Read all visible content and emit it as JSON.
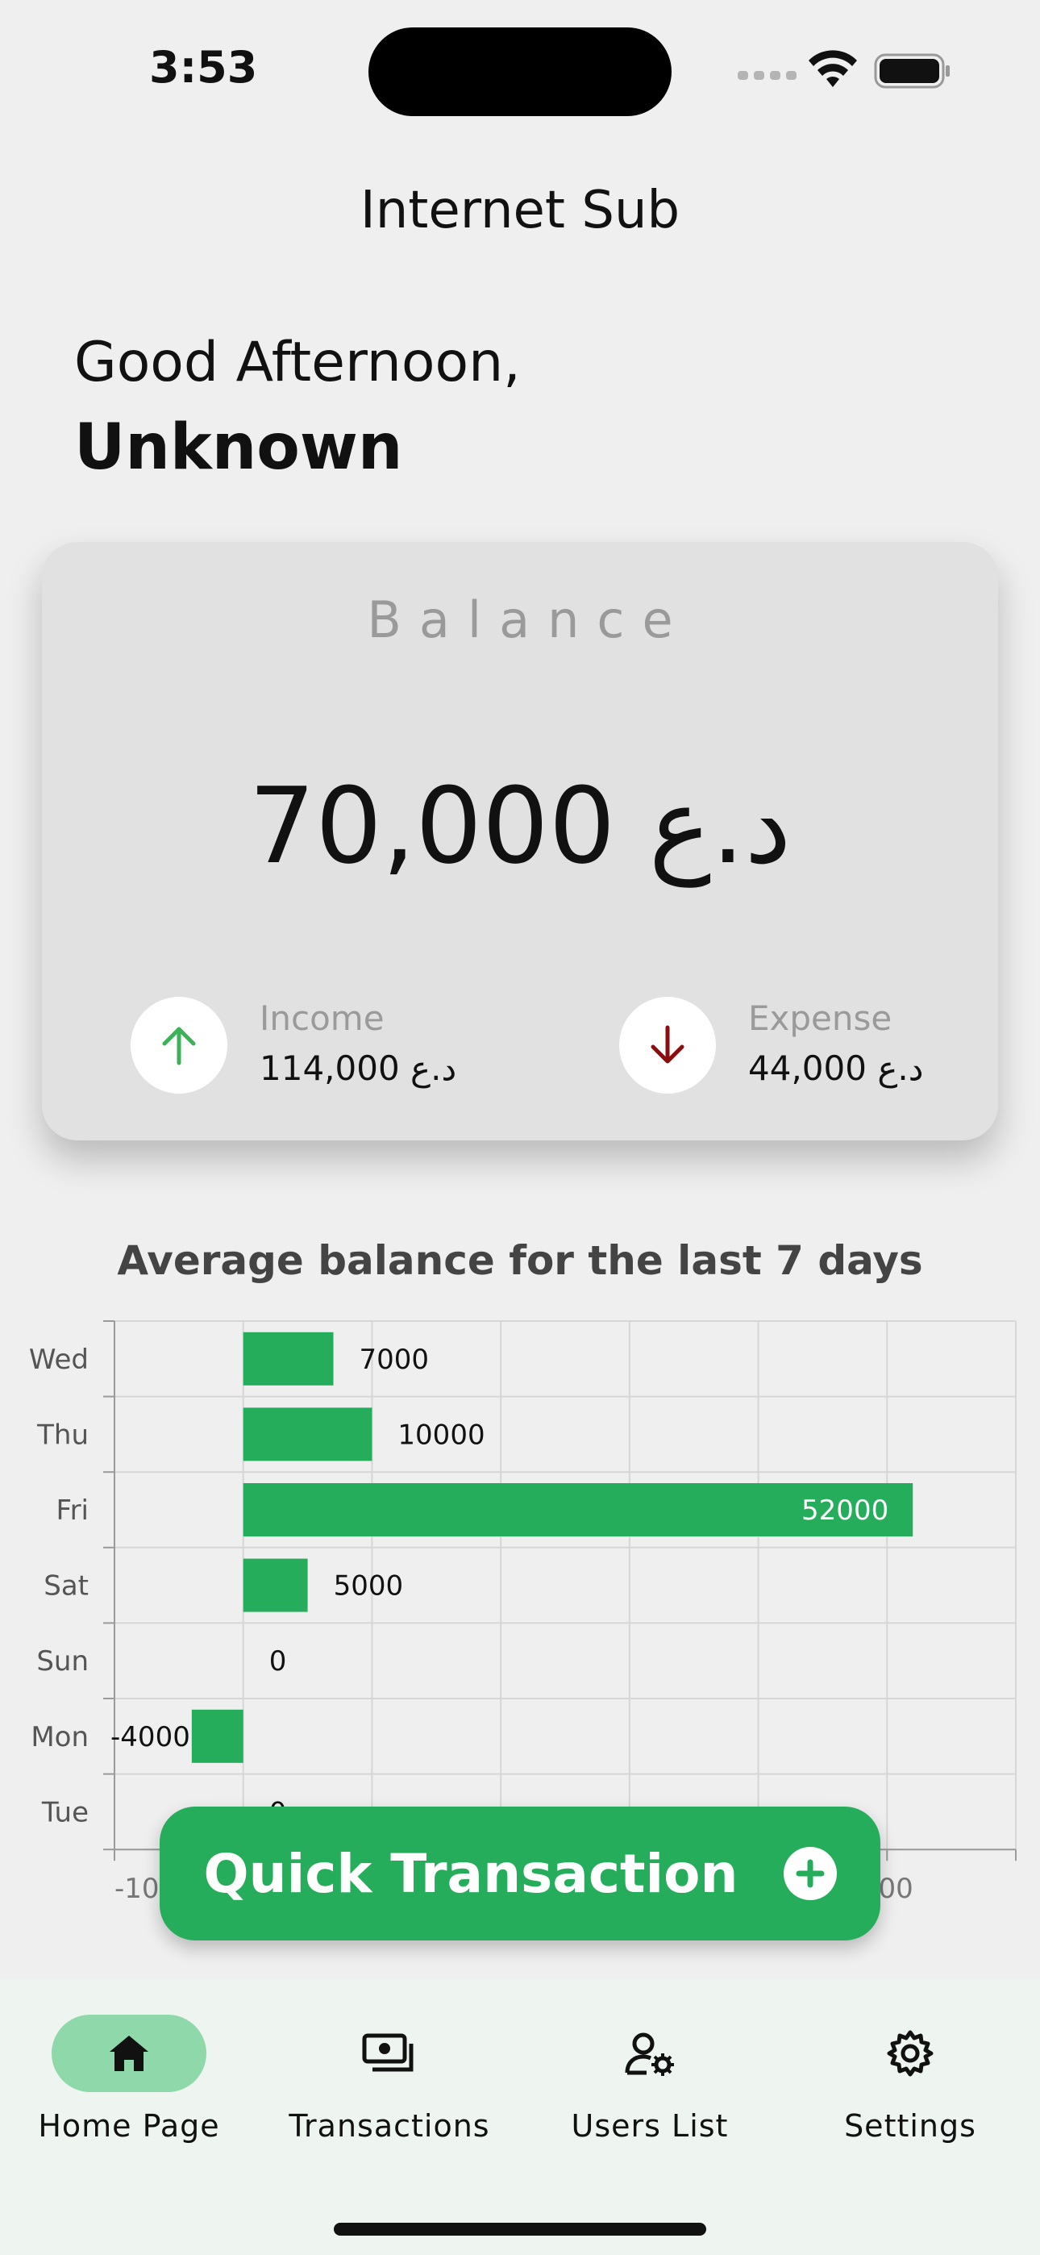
{
  "status_bar": {
    "time": "3:53"
  },
  "app_title": "Internet Sub",
  "greeting": {
    "salutation": "Good Afternoon,",
    "name": "Unknown"
  },
  "balance_card": {
    "label": "Balance",
    "amount": "70,000 د.ع",
    "income": {
      "label": "Income",
      "value": "114,000 د.ع",
      "color": "#3cb157"
    },
    "expense": {
      "label": "Expense",
      "value": "44,000 د.ع",
      "color": "#8b0e0e"
    }
  },
  "chart_data": {
    "type": "bar",
    "orientation": "horizontal",
    "title": "Average balance for the last 7 days",
    "categories": [
      "Wed",
      "Thu",
      "Fri",
      "Sat",
      "Sun",
      "Mon",
      "Tue"
    ],
    "values": [
      7000,
      10000,
      52000,
      5000,
      0,
      -4000,
      0
    ],
    "data_labels": [
      "7000",
      "10000",
      "52000",
      "5000",
      "0",
      "-4000",
      "0"
    ],
    "x_tick_labels": [
      "-10",
      "",
      "",
      "",
      "",
      "",
      "000"
    ],
    "xlim": [
      -10000,
      60000
    ],
    "grid": true,
    "bar_color": "#25ad5c"
  },
  "quick_transaction": {
    "label": "Quick Transaction"
  },
  "bottom_nav": {
    "items": [
      {
        "label": "Home Page",
        "icon": "home-icon",
        "active": true
      },
      {
        "label": "Transactions",
        "icon": "money-icon",
        "active": false
      },
      {
        "label": "Users List",
        "icon": "user-settings-icon",
        "active": false
      },
      {
        "label": "Settings",
        "icon": "gear-icon",
        "active": false
      }
    ]
  }
}
